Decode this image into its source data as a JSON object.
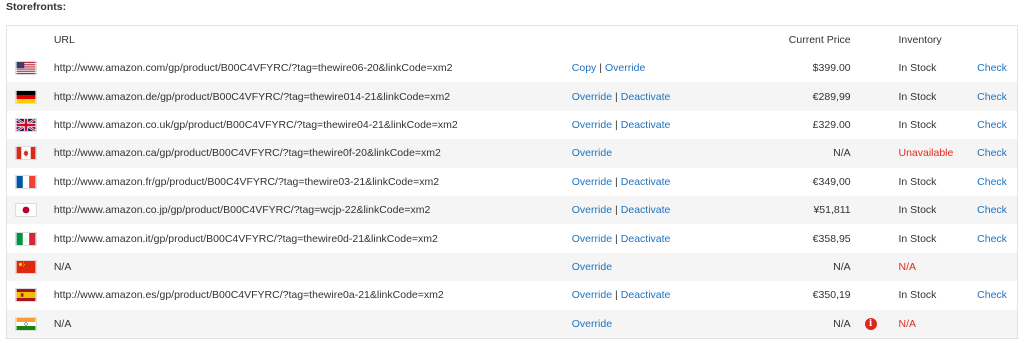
{
  "title": "Storefronts:",
  "headers": {
    "url": "URL",
    "price": "Current Price",
    "inventory": "Inventory"
  },
  "rows": [
    {
      "flag": "us",
      "url": "http://www.amazon.com/gp/product/B00C4VFYRC/?tag=thewire06-20&linkCode=xm2",
      "a1": "Copy",
      "a2": "Override",
      "price": "$399.00",
      "inv": "In Stock",
      "inv_status": "ok",
      "check": "Check",
      "info": false
    },
    {
      "flag": "de",
      "url": "http://www.amazon.de/gp/product/B00C4VFYRC/?tag=thewire014-21&linkCode=xm2",
      "a1": "Override",
      "a2": "Deactivate",
      "price": "€289,99",
      "inv": "In Stock",
      "inv_status": "ok",
      "check": "Check",
      "info": false
    },
    {
      "flag": "uk",
      "url": "http://www.amazon.co.uk/gp/product/B00C4VFYRC/?tag=thewire04-21&linkCode=xm2",
      "a1": "Override",
      "a2": "Deactivate",
      "price": "£329.00",
      "inv": "In Stock",
      "inv_status": "ok",
      "check": "Check",
      "info": false
    },
    {
      "flag": "ca",
      "url": "http://www.amazon.ca/gp/product/B00C4VFYRC/?tag=thewire0f-20&linkCode=xm2",
      "a1": "Override",
      "a2": "",
      "price": "N/A",
      "inv": "Unavailable",
      "inv_status": "error",
      "check": "Check",
      "info": false
    },
    {
      "flag": "fr",
      "url": "http://www.amazon.fr/gp/product/B00C4VFYRC/?tag=thewire03-21&linkCode=xm2",
      "a1": "Override",
      "a2": "Deactivate",
      "price": "€349,00",
      "inv": "In Stock",
      "inv_status": "ok",
      "check": "Check",
      "info": false
    },
    {
      "flag": "jp",
      "url": "http://www.amazon.co.jp/gp/product/B00C4VFYRC/?tag=wcjp-22&linkCode=xm2",
      "a1": "Override",
      "a2": "Deactivate",
      "price": "¥51,811",
      "inv": "In Stock",
      "inv_status": "ok",
      "check": "Check",
      "info": false
    },
    {
      "flag": "it",
      "url": "http://www.amazon.it/gp/product/B00C4VFYRC/?tag=thewire0d-21&linkCode=xm2",
      "a1": "Override",
      "a2": "Deactivate",
      "price": "€358,95",
      "inv": "In Stock",
      "inv_status": "ok",
      "check": "Check",
      "info": false
    },
    {
      "flag": "cn",
      "url": "N/A",
      "a1": "Override",
      "a2": "",
      "price": "N/A",
      "inv": "N/A",
      "inv_status": "error",
      "check": "",
      "info": false
    },
    {
      "flag": "es",
      "url": "http://www.amazon.es/gp/product/B00C4VFYRC/?tag=thewire0a-21&linkCode=xm2",
      "a1": "Override",
      "a2": "Deactivate",
      "price": "€350,19",
      "inv": "In Stock",
      "inv_status": "ok",
      "check": "Check",
      "info": false
    },
    {
      "flag": "in",
      "url": "N/A",
      "a1": "Override",
      "a2": "",
      "price": "N/A",
      "inv": "N/A",
      "inv_status": "error",
      "check": "",
      "info": true
    }
  ],
  "colors": {
    "link": "#1e73be",
    "error": "#e02b20",
    "alt_row": "#f5f5f5"
  }
}
